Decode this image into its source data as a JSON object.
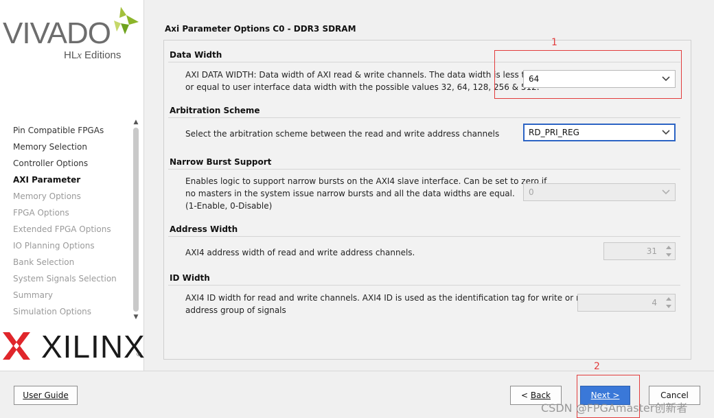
{
  "logo": {
    "product": "VIVADO",
    "edition_prefix": "HL",
    "edition_x": "x",
    "edition_suffix": " Editions",
    "brand": "XILINX",
    "registered": "®"
  },
  "nav": {
    "items": [
      {
        "label": "Pin Compatible FPGAs",
        "state": "normal"
      },
      {
        "label": "Memory Selection",
        "state": "normal"
      },
      {
        "label": "Controller Options",
        "state": "normal"
      },
      {
        "label": "AXI Parameter",
        "state": "active"
      },
      {
        "label": "Memory Options",
        "state": "disabled"
      },
      {
        "label": "FPGA Options",
        "state": "disabled"
      },
      {
        "label": "Extended FPGA Options",
        "state": "disabled"
      },
      {
        "label": "IO Planning Options",
        "state": "disabled"
      },
      {
        "label": "Bank Selection",
        "state": "disabled"
      },
      {
        "label": "System Signals Selection",
        "state": "disabled"
      },
      {
        "label": "Summary",
        "state": "disabled"
      },
      {
        "label": "Simulation Options",
        "state": "disabled"
      }
    ]
  },
  "page": {
    "title": "Axi Parameter Options C0 - DDR3 SDRAM"
  },
  "sections": {
    "data_width": {
      "heading": "Data Width",
      "desc_line1": "AXI DATA WIDTH: Data width of AXI read & write channels. The data width is less than",
      "desc_line2": "or equal to user interface data width with the possible values 32, 64, 128, 256 & 512.",
      "value": "64"
    },
    "arbitration": {
      "heading": "Arbitration Scheme",
      "desc": "Select the arbitration scheme between the read and write address channels",
      "value": "RD_PRI_REG"
    },
    "narrow_burst": {
      "heading": "Narrow Burst Support",
      "desc_line1": "Enables logic to support narrow bursts on the AXI4 slave interface. Can be set to zero if",
      "desc_line2": "no masters in the system issue narrow bursts and all the data widths are equal.",
      "desc_line3": "(1-Enable, 0-Disable)",
      "value": "0"
    },
    "address_width": {
      "heading": "Address Width",
      "desc": "AXI4 address width of read and write address channels.",
      "value": "31"
    },
    "id_width": {
      "heading": "ID Width",
      "desc_line1": "AXI4 ID width for read and write channels. AXI4 ID is used as the identification tag for write or read",
      "desc_line2": "address group of signals",
      "value": "4"
    }
  },
  "buttons": {
    "user_guide": "User Guide",
    "back_prefix": "< ",
    "back_label": "Back",
    "next_label": "Next >",
    "cancel": "Cancel"
  },
  "annotations": {
    "one": "1",
    "two": "2"
  },
  "watermark": "CSDN @FPGAmaster创新者",
  "colors": {
    "accent": "#3a78d8",
    "annotation": "#e23b3b",
    "focus": "#2b63c4"
  }
}
